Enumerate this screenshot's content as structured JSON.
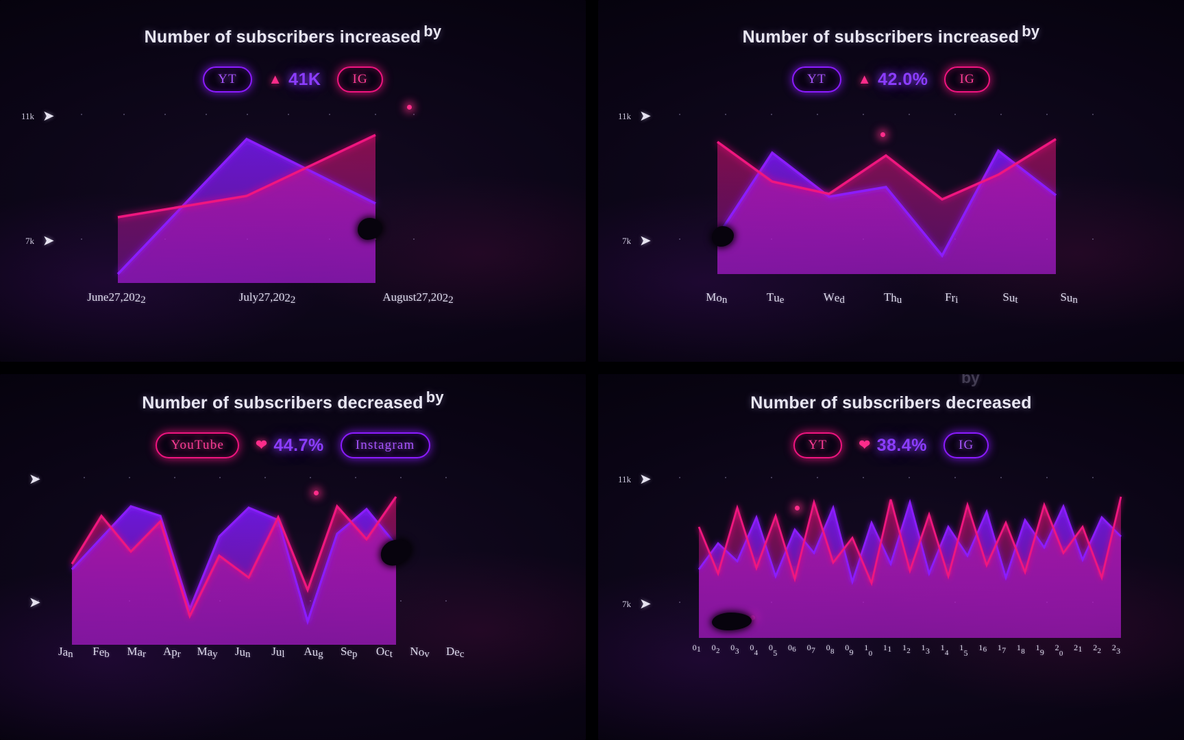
{
  "panels": [
    {
      "id": "top-left",
      "title": "Number of subscribers increased",
      "title_sup": "by",
      "left_pill": "YT",
      "left_pill_color": "#8b1bff",
      "metric_icon": "up-arrow-icon",
      "metric_value": "41K",
      "right_pill": "IG",
      "right_pill_color": "#f0147f",
      "y_ticks": [
        "11k",
        "7k"
      ],
      "x_ticks": [
        "June 27, 2022",
        "July 27, 2022",
        "August 27, 2022"
      ]
    },
    {
      "id": "top-right",
      "title": "Number of subscribers increased",
      "title_sup": "by",
      "left_pill": "YT",
      "left_pill_color": "#8b1bff",
      "metric_icon": "up-arrow-icon",
      "metric_value": "42.0%",
      "right_pill": "IG",
      "right_pill_color": "#f0147f",
      "y_ticks": [
        "11k",
        "7k"
      ],
      "x_ticks": [
        "Mon",
        "Tue",
        "Wed",
        "Thu",
        "Fri",
        "Sut",
        "Sun"
      ]
    },
    {
      "id": "bottom-left",
      "title": "Number of subscribers decreased",
      "title_sup": "by",
      "left_pill": "YouTube",
      "left_pill_color": "#f0147f",
      "metric_icon": "heart-icon",
      "metric_value": "44.7%",
      "right_pill": "Instagram",
      "right_pill_color": "#8b1bff",
      "y_ticks": [
        "",
        ""
      ],
      "x_ticks": [
        "Jan",
        "Feb",
        "Mar",
        "Apr",
        "May",
        "Jun",
        "Jul",
        "Aug",
        "Sep",
        "Oct",
        "Nov",
        "Dec"
      ]
    },
    {
      "id": "bottom-right",
      "title": "Number of subscribers decreased",
      "title_sup": "by",
      "ghost_text": "by",
      "left_pill": "YT",
      "left_pill_color": "#f0147f",
      "metric_icon": "heart-icon",
      "metric_value": "38.4%",
      "right_pill": "IG",
      "right_pill_color": "#8b1bff",
      "y_ticks": [
        "11k",
        "7k"
      ],
      "x_ticks": [
        "01",
        "02",
        "03",
        "04",
        "05",
        "06",
        "07",
        "08",
        "09",
        "10",
        "11",
        "12",
        "13",
        "14",
        "15",
        "16",
        "17",
        "18",
        "19",
        "20",
        "21",
        "22",
        "23"
      ]
    }
  ],
  "colors": {
    "youtube_violet": "#8b1bff",
    "instagram_pink": "#f0147f",
    "background": "#05020c",
    "panel": "#0b0516",
    "text": "#e8e6f2"
  },
  "chart_data": [
    {
      "type": "area",
      "title": "Number of subscribers increased by",
      "xlabel": "",
      "ylabel": "",
      "ylim": [
        7000,
        11000
      ],
      "grid": true,
      "legend": [
        "YT",
        "IG"
      ],
      "legend_position": "top",
      "categories": [
        "June 27, 2022",
        "July 27, 2022",
        "August 27, 2022"
      ],
      "x": [
        0,
        0.5,
        1
      ],
      "series": [
        {
          "name": "YT",
          "color": "#8b1bff",
          "values": [
            6900,
            10450,
            8500
          ]
        },
        {
          "name": "IG",
          "color": "#f0147f",
          "values": [
            8300,
            9100,
            10750
          ]
        }
      ]
    },
    {
      "type": "area",
      "title": "Number of subscribers increased by",
      "xlabel": "",
      "ylabel": "",
      "ylim": [
        7000,
        11000
      ],
      "grid": true,
      "legend": [
        "YT",
        "IG"
      ],
      "legend_position": "top",
      "categories": [
        "Mon",
        "Tue",
        "Wed",
        "Thu",
        "Fri",
        "Sut",
        "Sun"
      ],
      "series": [
        {
          "name": "YT",
          "color": "#8b1bff",
          "values": [
            7050,
            10050,
            8350,
            8700,
            6850,
            10150,
            8400
          ]
        },
        {
          "name": "IG",
          "color": "#f0147f",
          "values": [
            10350,
            8800,
            8450,
            9950,
            8200,
            9150,
            10500
          ]
        }
      ]
    },
    {
      "type": "area",
      "title": "Number of subscribers decreased by",
      "xlabel": "",
      "ylabel": "",
      "ylim": [
        7000,
        11000
      ],
      "grid": true,
      "legend": [
        "YouTube",
        "Instagram"
      ],
      "legend_position": "top",
      "categories": [
        "Jan",
        "Feb",
        "Mar",
        "Apr",
        "May",
        "Jun",
        "Jul",
        "Aug",
        "Sep",
        "Oct",
        "Nov",
        "Dec"
      ],
      "series": [
        {
          "name": "YouTube",
          "color": "#f0147f",
          "values": [
            8200,
            9850,
            8700,
            9700,
            7700,
            9000,
            8250,
            9750,
            8000,
            10050,
            9200,
            10700
          ]
        },
        {
          "name": "Instagram",
          "color": "#8b1bff",
          "values": [
            8050,
            8900,
            10200,
            9850,
            7550,
            9400,
            10050,
            9800,
            7450,
            9300,
            10100,
            9150
          ]
        }
      ]
    },
    {
      "type": "area",
      "title": "Number of subscribers decreased by",
      "xlabel": "",
      "ylabel": "",
      "ylim": [
        7000,
        11000
      ],
      "grid": true,
      "legend": [
        "YT",
        "IG"
      ],
      "legend_position": "top",
      "categories": [
        "01",
        "02",
        "03",
        "04",
        "05",
        "06",
        "07",
        "08",
        "09",
        "10",
        "11",
        "12",
        "13",
        "14",
        "15",
        "16",
        "17",
        "18",
        "19",
        "20",
        "21",
        "22",
        "23"
      ],
      "series": [
        {
          "name": "YT",
          "color": "#8b1bff",
          "values": [
            8500,
            9200,
            8700,
            9900,
            8300,
            9500,
            8900,
            10100,
            8200,
            9700,
            8600,
            10300,
            8450,
            9600,
            8800,
            10000,
            8350,
            9800,
            9100,
            10200,
            8700,
            9900,
            9400
          ]
        },
        {
          "name": "IG",
          "color": "#f0147f",
          "values": [
            9600,
            8400,
            10200,
            8600,
            9800,
            8350,
            10400,
            8700,
            9300,
            8250,
            10500,
            8550,
            9900,
            8400,
            10300,
            8650,
            9700,
            8500,
            10400,
            8900,
            9600,
            8450,
            10600
          ]
        }
      ]
    }
  ]
}
